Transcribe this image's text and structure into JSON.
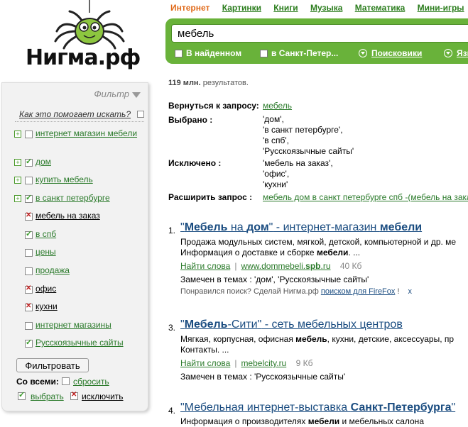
{
  "logo": {
    "text": "Нигма.рф"
  },
  "nav": {
    "items": [
      "Интернет",
      "Картинки",
      "Книги",
      "Музыка",
      "Математика",
      "Мини-игры"
    ]
  },
  "search": {
    "value": "мебель",
    "options": [
      "В найденном",
      "в Санкт-Петер...",
      "Поисковики",
      "Язы"
    ]
  },
  "filter": {
    "title": "Фильтр",
    "help": "Как это помогает искать?",
    "items": [
      {
        "label": "интернет магазин мебели"
      },
      {
        "label": "дом"
      },
      {
        "label": "купить мебель"
      },
      {
        "label": "в санкт петербурге"
      },
      {
        "label": "мебель на заказ"
      },
      {
        "label": "в спб"
      },
      {
        "label": "цены"
      },
      {
        "label": "продажа"
      },
      {
        "label": "офис"
      },
      {
        "label": "кухни"
      },
      {
        "label": "интернет магазины"
      },
      {
        "label": "Русскоязычные сайты"
      }
    ],
    "button": "Фильтровать",
    "all_label": "Со всеми:",
    "reset": "сбросить",
    "select": "выбрать",
    "exclude": "исключить"
  },
  "results": {
    "count_num": "119 млн.",
    "count_text": " результатов.",
    "back_label": "Вернуться к запросу:",
    "back_value": "мебель",
    "selected_label": "Выбрано :",
    "selected_values": [
      "'дом',",
      "'в санкт петербурге',",
      "'в спб',",
      "'Русскоязычные сайты'"
    ],
    "excluded_label": "Исключено :",
    "excluded_values": [
      "'мебель на заказ',",
      "'офис',",
      "'кухни'"
    ],
    "expand_label": "Расширить запрос :",
    "expand_value": "мебель дом в санкт петербурге спб -(мебель на заказ",
    "items": [
      {
        "num": "1.",
        "title_q1": "\"",
        "title_b1": "Мебель",
        "title_m1": " на ",
        "title_b2": "дом",
        "title_q2": "\"",
        "title_rest": " - интернет-магазин ",
        "title_b3": "мебели",
        "snippet1": "Продажа модульных систем, мягкой, детской, компьютерной и др. ме",
        "snippet2_a": "Информация о доставке и сборке ",
        "snippet2_b": "мебели",
        "snippet2_c": ". ...",
        "find": "Найти слова",
        "url_a": "www.dommebeli.",
        "url_b": "spb",
        "url_c": ".ru",
        "size": "40 Кб",
        "themes": "Замечен в темах : 'дом', 'Русскоязычные сайты'"
      },
      {
        "num": "3.",
        "title_q1": "\"",
        "title_b1": "Мебель",
        "title_m1": "-Сити",
        "title_q2": "\"",
        "title_rest": " - сеть мебельных центров",
        "snippet1_a": "Мягкая, корпусная, офисная ",
        "snippet1_b": "мебель",
        "snippet1_c": ", кухни, детские, аксессуары, пр",
        "snippet2": "Контакты. ...",
        "find": "Найти слова",
        "url": "mebelcity.ru",
        "size": "9 Кб",
        "themes": "Замечен в темах : 'Русскоязычные сайты'"
      },
      {
        "num": "4.",
        "title_a": "\"Мебельная интернет-выставка ",
        "title_b": "Санкт-Петербурга",
        "title_c": "\"",
        "snippet_a": "Информация о производителях ",
        "snippet_b": "мебели",
        "snippet_c": " и мебельных салона"
      }
    ],
    "promo_a": "Понравился поиск? Сделай Нигма.рф ",
    "promo_link": "поиском для FireFox",
    "promo_b": " !",
    "promo_close": "x"
  }
}
